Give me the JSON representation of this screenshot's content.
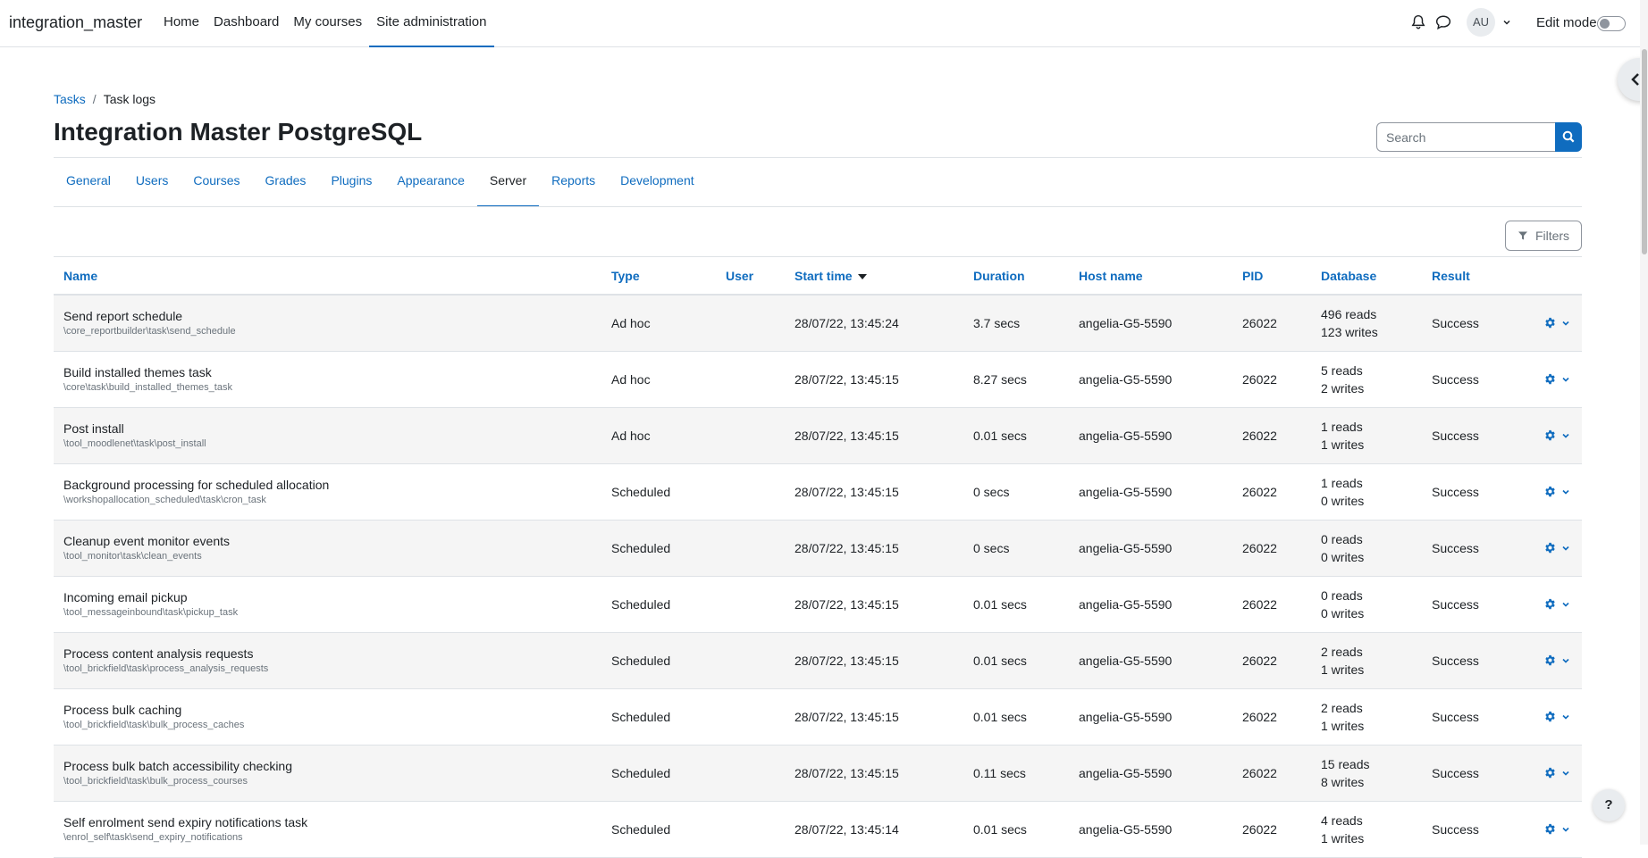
{
  "navbar": {
    "brand": "integration_master",
    "items": [
      {
        "label": "Home"
      },
      {
        "label": "Dashboard"
      },
      {
        "label": "My courses"
      },
      {
        "label": "Site administration"
      }
    ],
    "avatar_initials": "AU",
    "edit_mode_label": "Edit mode"
  },
  "breadcrumb": {
    "items": [
      {
        "label": "Tasks"
      }
    ],
    "current": "Task logs"
  },
  "page_title": "Integration Master PostgreSQL",
  "search": {
    "placeholder": "Search"
  },
  "tabs": [
    {
      "label": "General"
    },
    {
      "label": "Users"
    },
    {
      "label": "Courses"
    },
    {
      "label": "Grades"
    },
    {
      "label": "Plugins"
    },
    {
      "label": "Appearance"
    },
    {
      "label": "Server"
    },
    {
      "label": "Reports"
    },
    {
      "label": "Development"
    }
  ],
  "filters_label": "Filters",
  "table": {
    "headers": {
      "name": "Name",
      "type": "Type",
      "user": "User",
      "start_time": "Start time",
      "duration": "Duration",
      "host": "Host name",
      "pid": "PID",
      "database": "Database",
      "result": "Result"
    },
    "rows": [
      {
        "name": "Send report schedule",
        "class": "\\core_reportbuilder\\task\\send_schedule",
        "type": "Ad hoc",
        "user": "",
        "start": "28/07/22, 13:45:24",
        "duration": "3.7 secs",
        "host": "angelia-G5-5590",
        "pid": "26022",
        "reads": "496 reads",
        "writes": "123 writes",
        "result": "Success"
      },
      {
        "name": "Build installed themes task",
        "class": "\\core\\task\\build_installed_themes_task",
        "type": "Ad hoc",
        "user": "",
        "start": "28/07/22, 13:45:15",
        "duration": "8.27 secs",
        "host": "angelia-G5-5590",
        "pid": "26022",
        "reads": "5 reads",
        "writes": "2 writes",
        "result": "Success"
      },
      {
        "name": "Post install",
        "class": "\\tool_moodlenet\\task\\post_install",
        "type": "Ad hoc",
        "user": "",
        "start": "28/07/22, 13:45:15",
        "duration": "0.01 secs",
        "host": "angelia-G5-5590",
        "pid": "26022",
        "reads": "1 reads",
        "writes": "1 writes",
        "result": "Success"
      },
      {
        "name": "Background processing for scheduled allocation",
        "class": "\\workshopallocation_scheduled\\task\\cron_task",
        "type": "Scheduled",
        "user": "",
        "start": "28/07/22, 13:45:15",
        "duration": "0 secs",
        "host": "angelia-G5-5590",
        "pid": "26022",
        "reads": "1 reads",
        "writes": "0 writes",
        "result": "Success"
      },
      {
        "name": "Cleanup event monitor events",
        "class": "\\tool_monitor\\task\\clean_events",
        "type": "Scheduled",
        "user": "",
        "start": "28/07/22, 13:45:15",
        "duration": "0 secs",
        "host": "angelia-G5-5590",
        "pid": "26022",
        "reads": "0 reads",
        "writes": "0 writes",
        "result": "Success"
      },
      {
        "name": "Incoming email pickup",
        "class": "\\tool_messageinbound\\task\\pickup_task",
        "type": "Scheduled",
        "user": "",
        "start": "28/07/22, 13:45:15",
        "duration": "0.01 secs",
        "host": "angelia-G5-5590",
        "pid": "26022",
        "reads": "0 reads",
        "writes": "0 writes",
        "result": "Success"
      },
      {
        "name": "Process content analysis requests",
        "class": "\\tool_brickfield\\task\\process_analysis_requests",
        "type": "Scheduled",
        "user": "",
        "start": "28/07/22, 13:45:15",
        "duration": "0.01 secs",
        "host": "angelia-G5-5590",
        "pid": "26022",
        "reads": "2 reads",
        "writes": "1 writes",
        "result": "Success"
      },
      {
        "name": "Process bulk caching",
        "class": "\\tool_brickfield\\task\\bulk_process_caches",
        "type": "Scheduled",
        "user": "",
        "start": "28/07/22, 13:45:15",
        "duration": "0.01 secs",
        "host": "angelia-G5-5590",
        "pid": "26022",
        "reads": "2 reads",
        "writes": "1 writes",
        "result": "Success"
      },
      {
        "name": "Process bulk batch accessibility checking",
        "class": "\\tool_brickfield\\task\\bulk_process_courses",
        "type": "Scheduled",
        "user": "",
        "start": "28/07/22, 13:45:15",
        "duration": "0.11 secs",
        "host": "angelia-G5-5590",
        "pid": "26022",
        "reads": "15 reads",
        "writes": "8 writes",
        "result": "Success"
      },
      {
        "name": "Self enrolment send expiry notifications task",
        "class": "\\enrol_self\\task\\send_expiry_notifications",
        "type": "Scheduled",
        "user": "",
        "start": "28/07/22, 13:45:14",
        "duration": "0.01 secs",
        "host": "angelia-G5-5590",
        "pid": "26022",
        "reads": "4 reads",
        "writes": "1 writes",
        "result": "Success"
      }
    ]
  },
  "help_label": "?",
  "colors": {
    "accent": "#0f6cbf",
    "text": "#1d2125",
    "muted": "#6a737b",
    "stripe": "#f5f5f5"
  }
}
